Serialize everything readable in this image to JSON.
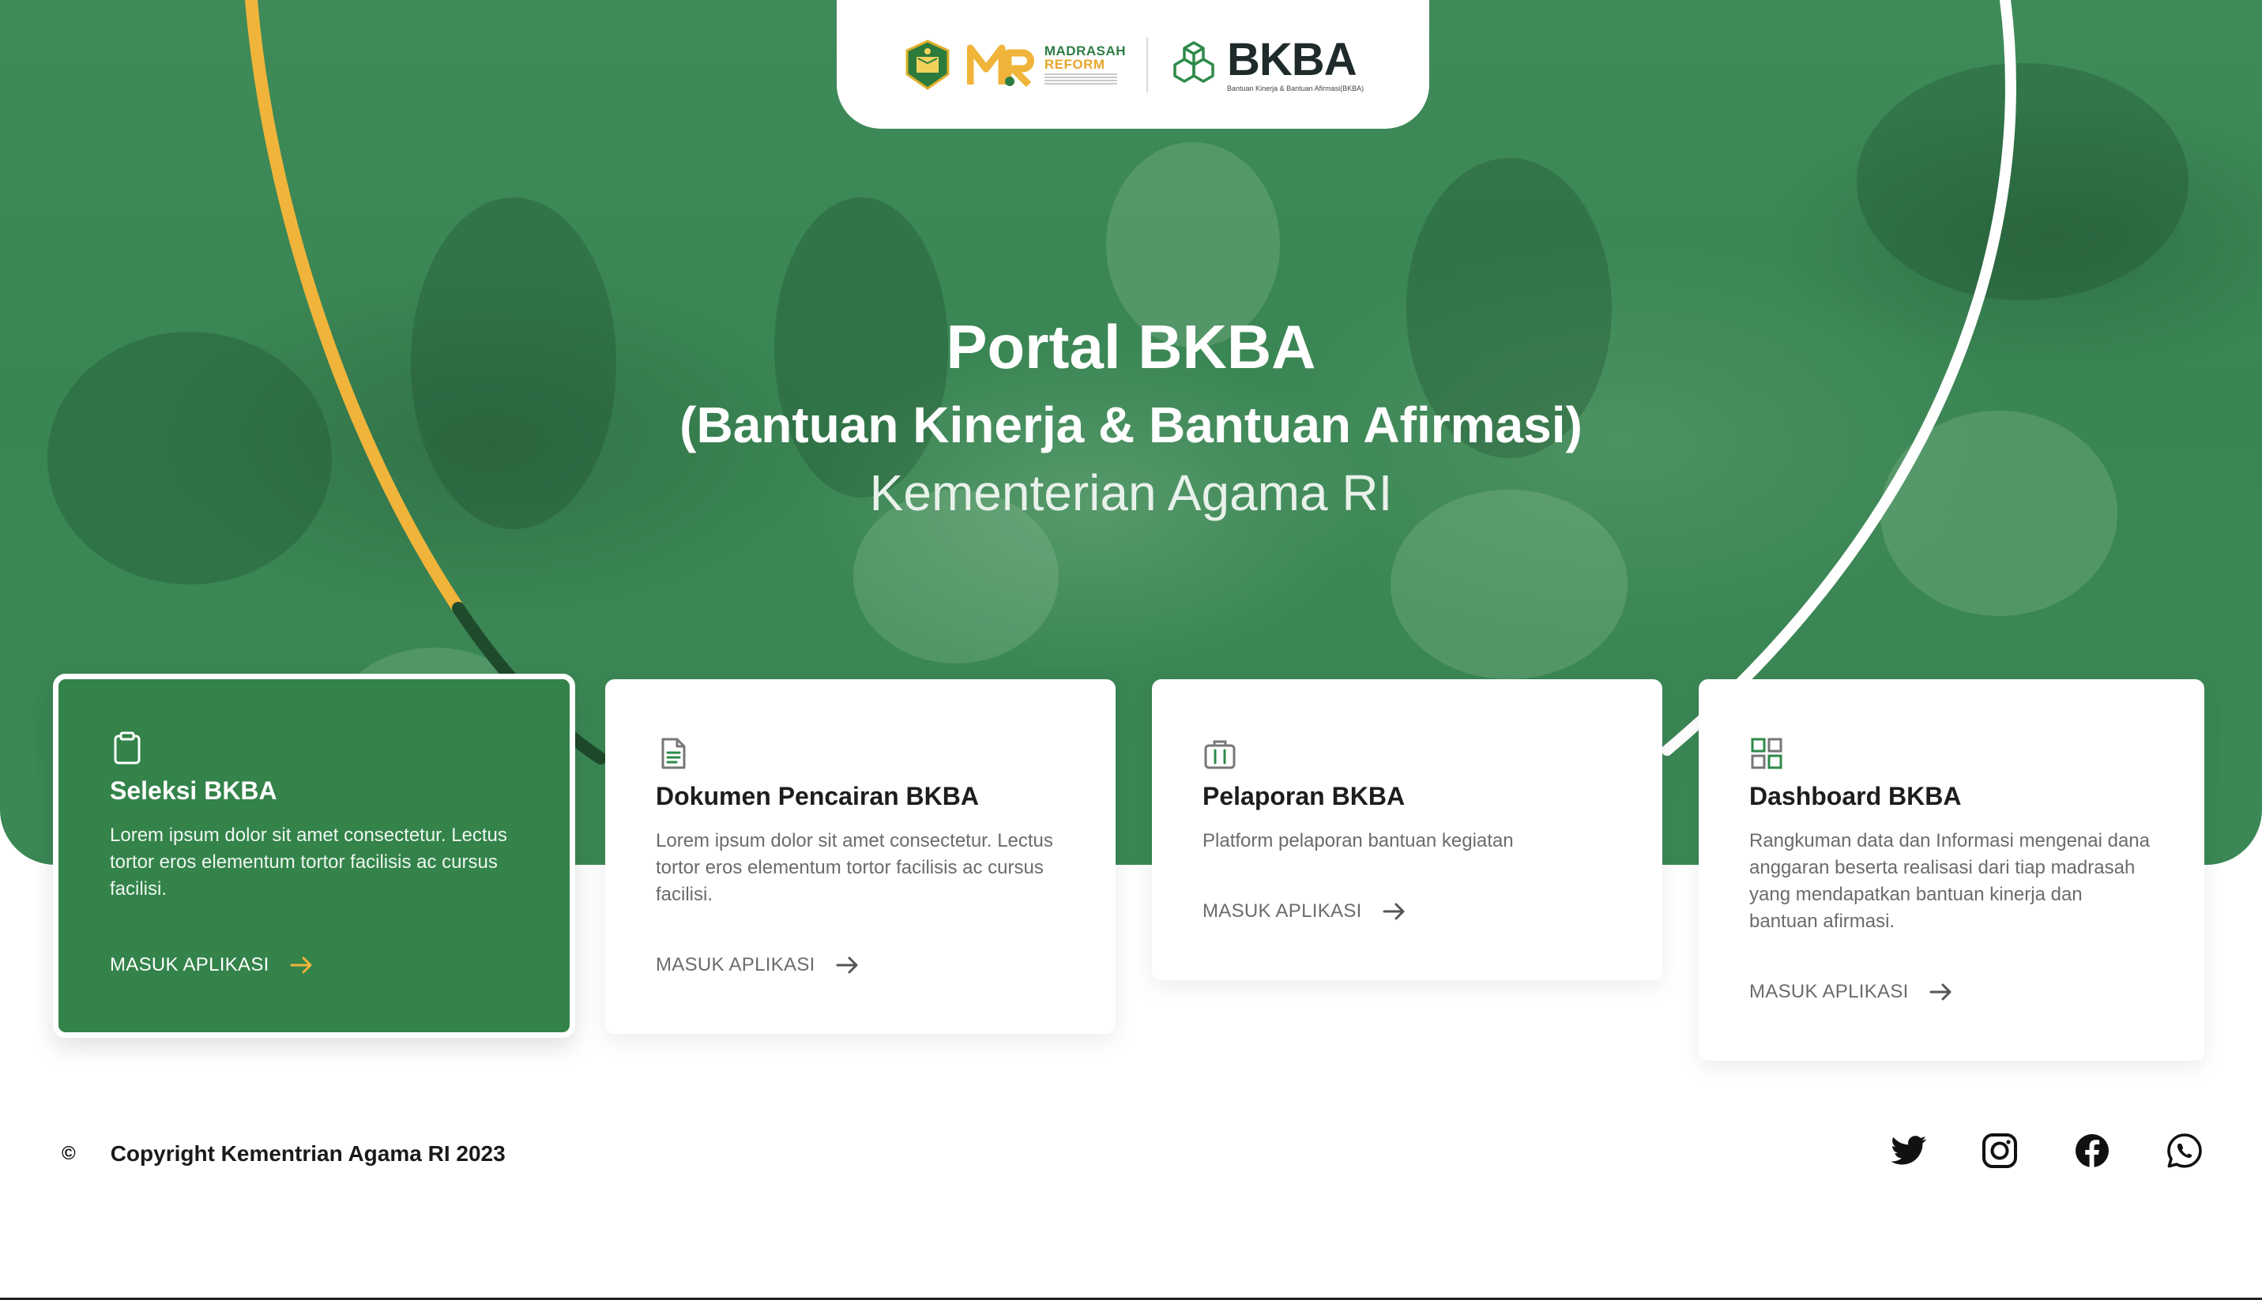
{
  "header": {
    "madrasah_line1": "MADRASAH",
    "madrasah_line2": "REFORM",
    "brand_name": "BKBA",
    "brand_tagline": "Bantuan Kinerja & Bantuan Afirmasi(BKBA)"
  },
  "hero": {
    "title": "Portal BKBA",
    "subtitle": "(Bantuan Kinerja & Bantuan Afirmasi)",
    "organization": "Kementerian Agama RI"
  },
  "cards": [
    {
      "title": "Seleksi BKBA",
      "description": "Lorem ipsum dolor sit amet consectetur. Lectus tortor eros elementum tortor facilisis ac cursus facilisi.",
      "link": "MASUK APLIKASI",
      "icon": "clipboard-icon"
    },
    {
      "title": "Dokumen Pencairan BKBA",
      "description": "Lorem ipsum dolor sit amet consectetur. Lectus tortor eros elementum tortor facilisis ac cursus facilisi.",
      "link": "MASUK APLIKASI",
      "icon": "document-icon"
    },
    {
      "title": "Pelaporan BKBA",
      "description": "Platform pelaporan bantuan kegiatan",
      "link": "MASUK APLIKASI",
      "icon": "briefcase-icon"
    },
    {
      "title": "Dashboard BKBA",
      "description": "Rangkuman data dan Informasi mengenai dana anggaran beserta realisasi dari tiap madrasah yang mendapatkan bantuan kinerja dan bantuan afirmasi.",
      "link": "MASUK APLIKASI",
      "icon": "dashboard-grid-icon"
    }
  ],
  "footer": {
    "copyright_symbol": "©",
    "copyright": "Copyright Kementrian Agama RI 2023",
    "social": [
      "twitter-icon",
      "instagram-icon",
      "facebook-icon",
      "whatsapp-icon"
    ]
  },
  "colors": {
    "primary_green": "#33834a",
    "accent_yellow": "#f0b43a",
    "text_dark": "#1d1d1d",
    "text_muted": "#6b6b6b"
  }
}
